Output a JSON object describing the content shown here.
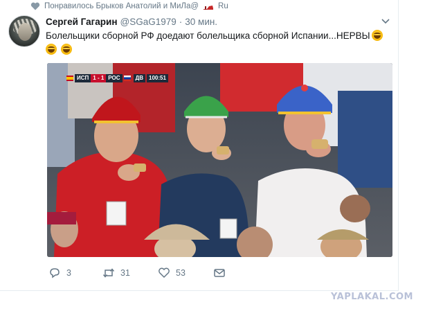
{
  "liked": {
    "text": "Понравилось Брыков Анатолий и МиЛа@",
    "suffix": "Ru"
  },
  "tweet": {
    "name": "Сергей Гагарин",
    "handle": "@SGaG1979",
    "separator": "·",
    "time": "30 мин.",
    "text_line1": "Болельщики сборной РФ доедают болельщика сборной Испании...НЕРВЫ",
    "emoji_name": "grinning-squinting-face"
  },
  "photo": {
    "scoreboard": {
      "team1": "ИСП",
      "score": "1 - 1",
      "team2": "РОС",
      "period": "ДВ",
      "clock": "100:51"
    }
  },
  "actions": {
    "replies": "3",
    "retweets": "31",
    "likes": "53"
  },
  "watermark": "YAPLAKAL.COM",
  "colors": {
    "text": "#14171a",
    "muted": "#657786",
    "watermark": "#b9c1d8"
  }
}
